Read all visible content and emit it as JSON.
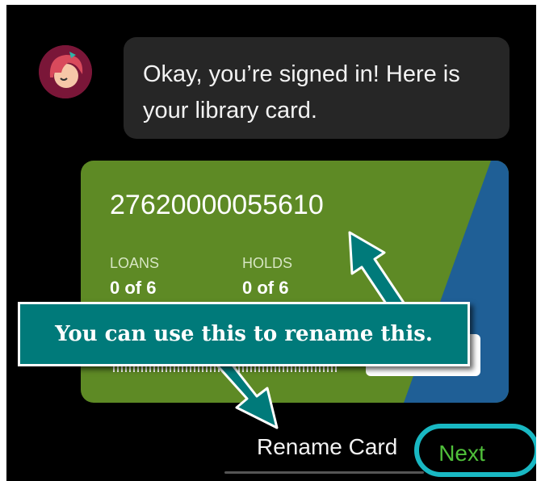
{
  "chat": {
    "message": "Okay, you’re signed in! Here is your library card."
  },
  "card": {
    "number": "27620000055610",
    "loans_label": "LOANS",
    "loans_value": "0 of 6",
    "holds_label": "HOLDS",
    "holds_value": "0 of 6",
    "color": "#5e8a25",
    "stripe_color": "#1f5f96"
  },
  "annotation": {
    "text": "You can use this to rename this.",
    "color": "#007a7a"
  },
  "actions": {
    "rename_label": "Rename Card",
    "next_label": "Next",
    "next_color": "#4fbf3a",
    "highlight_color": "#19b8c3"
  }
}
